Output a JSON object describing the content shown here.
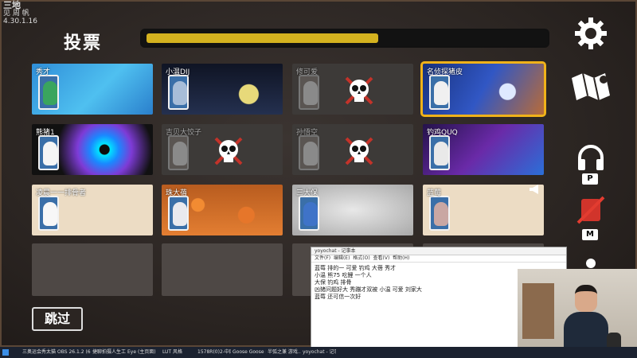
{
  "overlay": {
    "logo": "三地",
    "line1": "见 周 帆",
    "line2": "4.30.1.16"
  },
  "screen": {
    "title": "投票",
    "progress": 0.57,
    "skip_label": "跳过"
  },
  "players": [
    {
      "name": "秀才",
      "state": "alive",
      "bg": "pond",
      "goose_color": "#3aa55e"
    },
    {
      "name": "小温DIJ",
      "state": "alive",
      "bg": "night",
      "goose_color": "#a7bdd8"
    },
    {
      "name": "修可爱",
      "state": "dead",
      "bg": "",
      "goose_color": "#8a8a8a"
    },
    {
      "name": "名侦探猪皮",
      "state": "selected",
      "bg": "space",
      "goose_color": "#f0f0f0"
    },
    {
      "name": "熊猪1",
      "state": "alive",
      "bg": "warp",
      "goose_color": "#f5f5f5"
    },
    {
      "name": "吉贝大饺子",
      "state": "dead",
      "bg": "",
      "goose_color": "#8a8a8a"
    },
    {
      "name": "孙悟空",
      "state": "dead",
      "bg": "",
      "goose_color": "#8a8a8a"
    },
    {
      "name": "钓鸡QUQ",
      "state": "alive",
      "bg": "purple",
      "goose_color": "#e9e9e9"
    },
    {
      "name": "凌晨一一排骨者",
      "state": "alive",
      "bg": "beige",
      "goose_color": "#f7f7f7"
    },
    {
      "name": "珠大蓓",
      "state": "alive",
      "bg": "orange",
      "goose_color": "#e9e9ee"
    },
    {
      "name": "三大保",
      "state": "alive",
      "bg": "mist",
      "goose_color": "#3f73c8"
    },
    {
      "name": "蓝莓",
      "state": "alive",
      "bg": "beige",
      "goose_color": "#c9a7a3"
    },
    {
      "name": "",
      "state": "empty",
      "bg": "",
      "goose_color": ""
    },
    {
      "name": "",
      "state": "empty",
      "bg": "",
      "goose_color": ""
    },
    {
      "name": "",
      "state": "empty",
      "bg": "",
      "goose_color": ""
    },
    {
      "name": "",
      "state": "empty",
      "bg": "",
      "goose_color": ""
    }
  ],
  "sidebar": {
    "settings_icon": "gear-icon",
    "map_icon": "map-icon",
    "push_to_talk_key": "P",
    "mute_key": "M"
  },
  "chat_window": {
    "title": "yoyochat - 记事本",
    "menu": [
      "文件(F)",
      "编辑(E)",
      "格式(O)",
      "查看(V)",
      "帮助(H)"
    ],
    "lines": [
      "蓝莓 排的一 可爱 钓鸡 大蓓 秀才",
      "小温 熊75 吃鲤 一个人",
      "大保 钓鸡 排骨",
      "凶猪问题好大 秀蹦才双被 小温 可爱 刘家大",
      "蓝莓 还可信一次好"
    ]
  },
  "taskbar": {
    "items": [
      "三奥运会秀太猫中国",
      "OBS 26.1.2 (64 bit)",
      "捷聊拍摄人生工作室...",
      "Eye (主页面)",
      "LUT 风格",
      "1578R(0)2-中国剧...",
      "Goose Goose Duck",
      "半弧之兼 游戏...",
      "yoyochat - 记事..."
    ]
  }
}
